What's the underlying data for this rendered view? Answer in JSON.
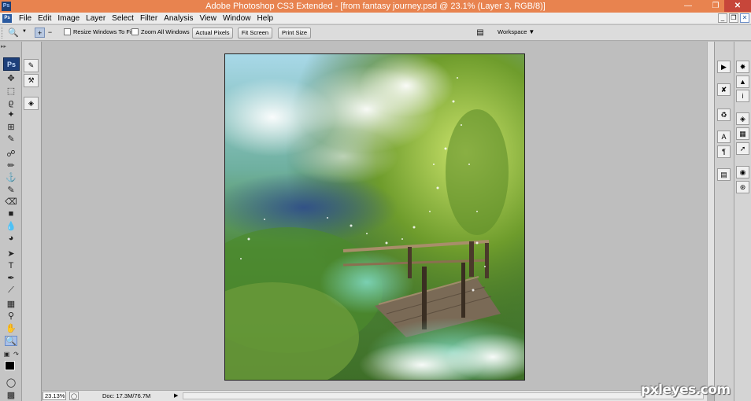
{
  "window": {
    "title": "Adobe Photoshop CS3 Extended - [from fantasy journey.psd @ 23.1% (Layer 3, RGB/8)]",
    "app_icon_text": "Ps"
  },
  "menu": {
    "items": [
      "File",
      "Edit",
      "Image",
      "Layer",
      "Select",
      "Filter",
      "Analysis",
      "View",
      "Window",
      "Help"
    ]
  },
  "options_bar": {
    "resize_windows_label": "Resize Windows To Fit",
    "zoom_all_label": "Zoom All Windows",
    "actual_pixels_label": "Actual Pixels",
    "fit_screen_label": "Fit Screen",
    "print_size_label": "Print Size",
    "workspace_label": "Workspace"
  },
  "toolbox": {
    "badge": "Ps"
  },
  "status": {
    "zoom": "23.13%",
    "doc_size": "Doc: 17.3M/76.7M"
  },
  "watermark": "pxleyes.com",
  "colors": {
    "titlebar": "#e8834f",
    "close_button": "#c7463a",
    "foreground_swatch": "#000000"
  }
}
